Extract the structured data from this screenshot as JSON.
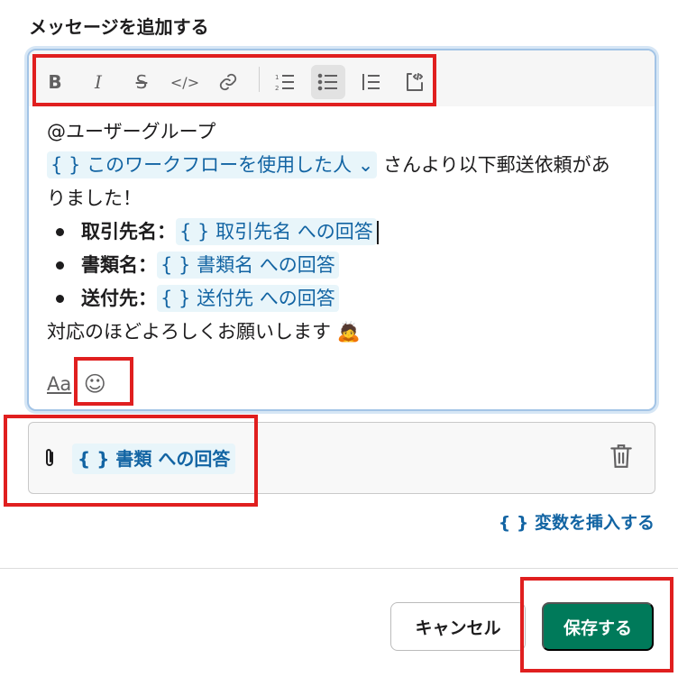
{
  "section_title": "メッセージを追加する",
  "toolbar": {
    "bold_label": "B",
    "italic_label": "I",
    "strike_label": "S",
    "code_label": "</>",
    "link_icon": "link-icon",
    "ordered_list_icon": "ordered-list-icon",
    "bullet_list_icon": "bullet-list-icon",
    "blockquote_icon": "blockquote-icon",
    "code_block_icon": "code-block-icon"
  },
  "message": {
    "line1": "@ユーザーグループ",
    "workflow_user_chip": "{ } このワークフローを使用した人 ⌄",
    "line2_tail": " さんより以下郵送依頼があ",
    "line3": "りました！",
    "bullets": [
      {
        "label": "取引先名：",
        "chip": "{ } 取引先名 への回答"
      },
      {
        "label": "書類名：",
        "chip": "{ } 書類名 への回答"
      },
      {
        "label": "送付先：",
        "chip": "{ } 送付先 への回答"
      }
    ],
    "closing": "対応のほどよろしくお願いします 🙇"
  },
  "bottom_tools": {
    "format_label": "Aa",
    "emoji_glyph": "☺"
  },
  "attachment": {
    "chip": "{ } 書類 への回答"
  },
  "insert_variable_label": "{ } 変数を挿入する",
  "buttons": {
    "cancel": "キャンセル",
    "save": "保存する"
  },
  "colors": {
    "accent": "#1264a3",
    "save_green": "#007a5a",
    "highlight_red": "#e01f1f"
  }
}
